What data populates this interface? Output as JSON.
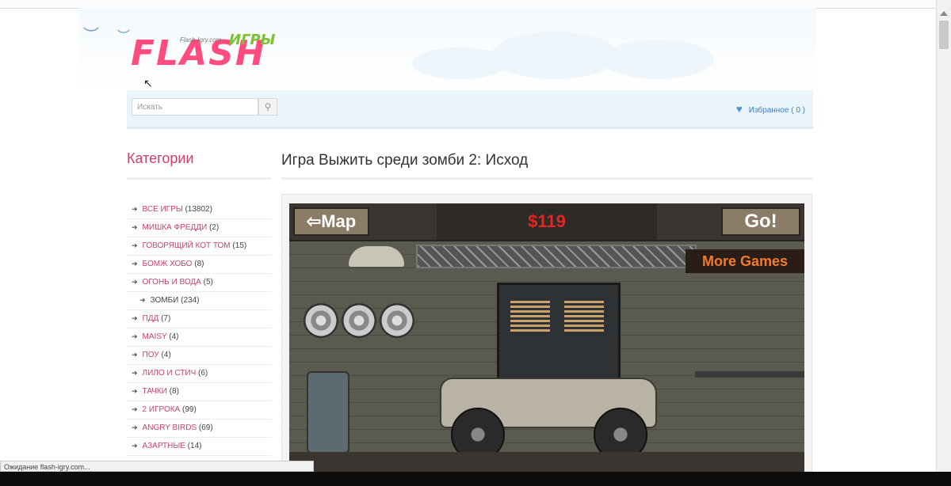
{
  "header": {
    "logo_main": "FLASH",
    "logo_sub": "ИГРЫ",
    "logo_site": "Flash-Igry.com"
  },
  "search": {
    "placeholder": "Искать",
    "button_icon": "search-icon"
  },
  "favorites": {
    "label": "Избранное ( 0 )",
    "icon": "heart-icon"
  },
  "sidebar": {
    "title": "Категории",
    "items": [
      {
        "label": "ВСЕ ИГРЫ",
        "count": "(13802)"
      },
      {
        "label": "МИШКА ФРЕДДИ",
        "count": "(2)"
      },
      {
        "label": "ГОВОРЯЩИЙ КОТ ТОМ",
        "count": "(15)"
      },
      {
        "label": "БОМЖ ХОБО",
        "count": "(8)"
      },
      {
        "label": "ОГОНЬ И ВОДА",
        "count": "(5)"
      },
      {
        "label": "ЗОМБИ",
        "count": "(234)"
      },
      {
        "label": "ПДД",
        "count": "(7)"
      },
      {
        "label": "MAISY",
        "count": "(4)"
      },
      {
        "label": "ПОУ",
        "count": "(4)"
      },
      {
        "label": "ЛИЛО И СТИЧ",
        "count": "(6)"
      },
      {
        "label": "ТАЧКИ",
        "count": "(8)"
      },
      {
        "label": "2 ИГРОКА",
        "count": "(99)"
      },
      {
        "label": "ANGRY BIRDS",
        "count": "(69)"
      },
      {
        "label": "АЗАРТНЫЕ",
        "count": "(14)"
      }
    ]
  },
  "main": {
    "title": "Игра Выжить среди зомби 2: Исход"
  },
  "game": {
    "map_button": "Map",
    "money": "$119",
    "go_button": "Go!",
    "more_games": "More Games"
  },
  "status_bar": {
    "text": "Ожидание flash-igry.com..."
  }
}
